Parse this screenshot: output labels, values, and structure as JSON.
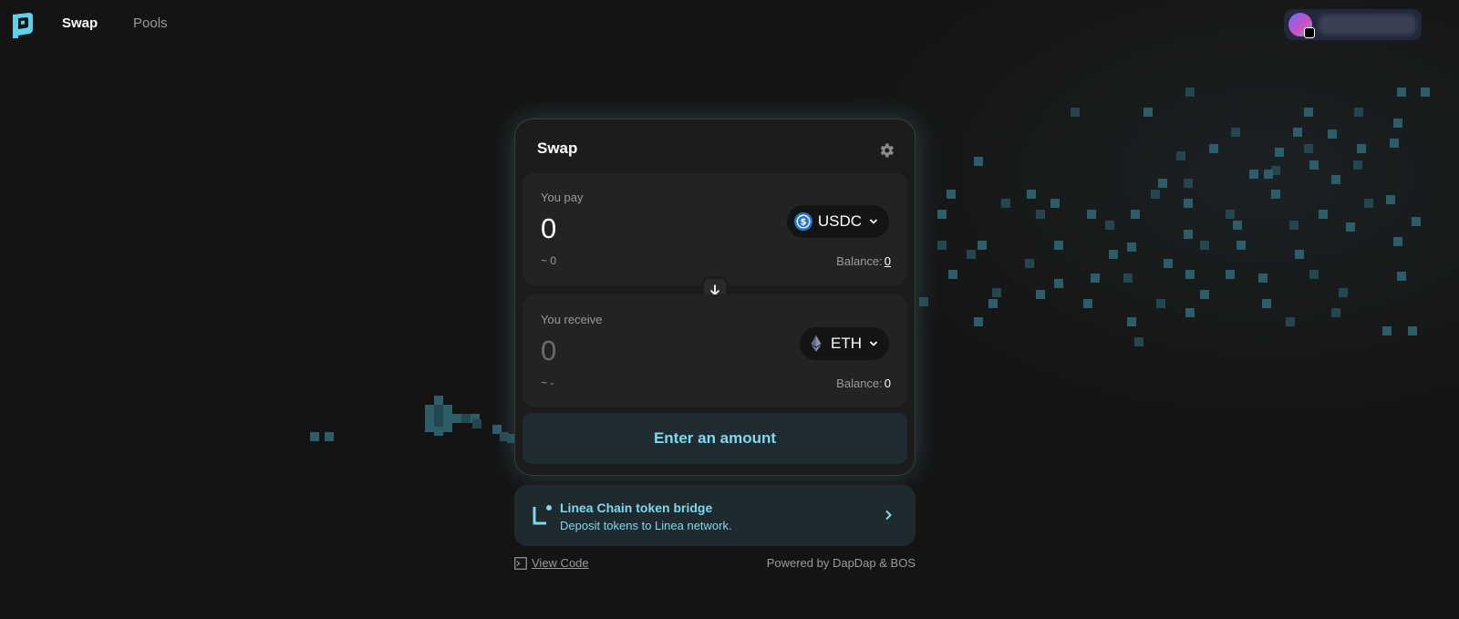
{
  "nav": {
    "swap_label": "Swap",
    "pools_label": "Pools"
  },
  "swap_card": {
    "title": "Swap",
    "pay": {
      "label": "You pay",
      "amount": "0",
      "usd_value": "~ 0",
      "token": "USDC",
      "balance_label": "Balance:",
      "balance_value": "0"
    },
    "receive": {
      "label": "You receive",
      "amount": "0",
      "usd_value": "~ -",
      "token": "ETH",
      "balance_label": "Balance:",
      "balance_value": "0"
    },
    "cta_label": "Enter an amount"
  },
  "bridge": {
    "title": "Linea Chain token bridge",
    "subtitle": "Deposit tokens to Linea network."
  },
  "footer": {
    "view_code": "View Code",
    "powered_by": "Powered by DapDap & BOS"
  },
  "colors": {
    "background": "#141414",
    "card": "#1c1c1c",
    "accent": "#7fd8ee",
    "pixel": "#2e5d6a"
  },
  "icons": {
    "logo": "dapdap-logo-icon",
    "settings": "gear-icon",
    "usdc": "usdc-token-icon",
    "eth": "eth-token-icon",
    "switch": "arrow-down-icon",
    "bridge": "linea-icon",
    "code": "terminal-icon"
  }
}
